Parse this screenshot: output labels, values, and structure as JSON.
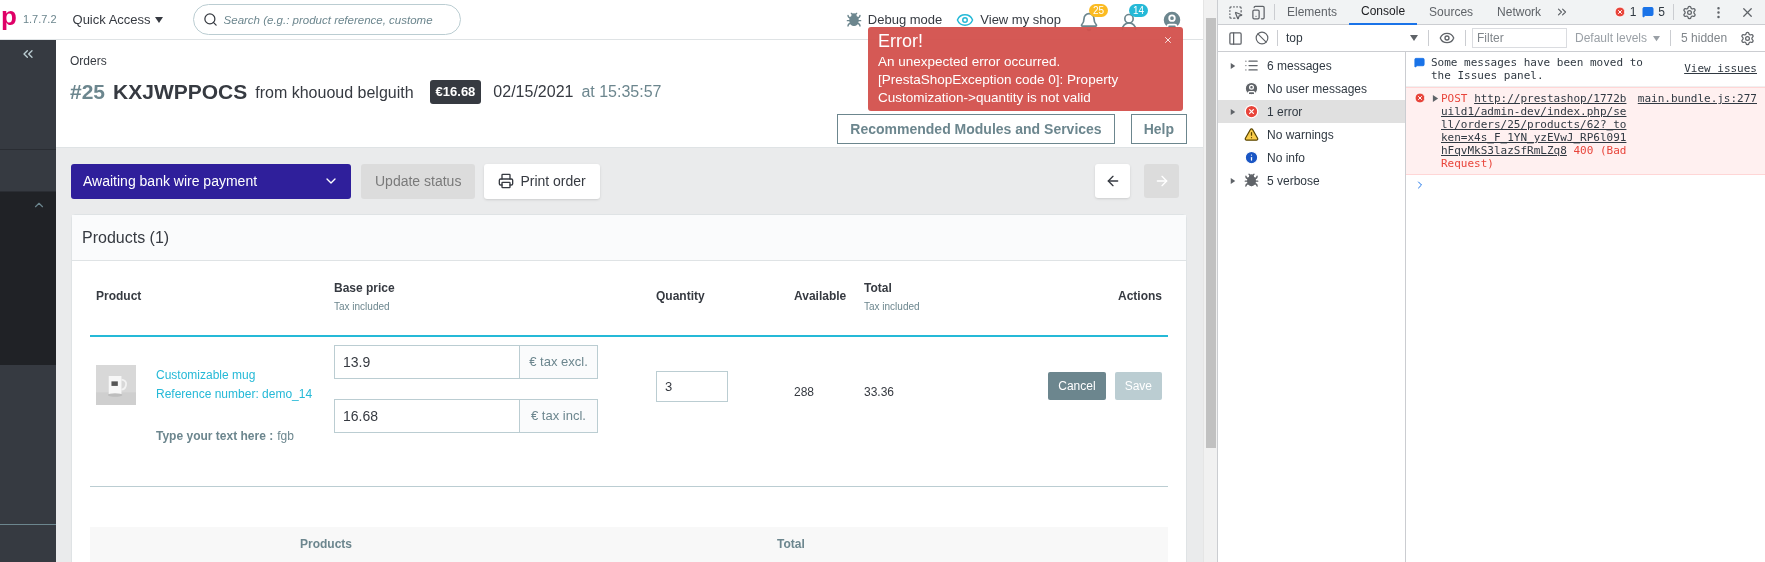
{
  "header": {
    "logo_text": "p",
    "version": "1.7.7.2",
    "quick_access": "Quick Access",
    "search": {
      "placeholder": "Search (e.g.: product reference, custome"
    },
    "debug_mode": "Debug mode",
    "view_shop": "View my shop",
    "notifications": [
      {
        "kind": "orders",
        "count": "25",
        "color": "#fbbb22"
      },
      {
        "kind": "customers",
        "count": "14",
        "color": "#25b9d7"
      }
    ]
  },
  "page_head": {
    "breadcrumb": "Orders",
    "order_number": "#25",
    "reference": "KXJWPPOCS",
    "customer": "from khououd belguith",
    "total": "€16.68",
    "date": "02/15/2021",
    "time": "at 15:35:57",
    "buttons": [
      "Recommended Modules and Services",
      "Help"
    ]
  },
  "toast": {
    "title": "Error!",
    "message": "An unexpected error occurred. [PrestaShopException code 0]: Property Customization->quantity is not valid"
  },
  "toolbar": {
    "status": "Awaiting bank wire payment",
    "update_button": {
      "label": "Update status",
      "disabled": true
    },
    "print_button": "Print order",
    "nav": [
      {
        "kind": "previous",
        "disabled": false
      },
      {
        "kind": "next",
        "disabled": true
      }
    ]
  },
  "products": {
    "title": "Products (1)",
    "columns": [
      {
        "label": "Product"
      },
      {
        "label": "Base price",
        "note": "Tax included"
      },
      {
        "label": "Quantity"
      },
      {
        "label": "Available"
      },
      {
        "label": "Total",
        "note": "Tax included"
      },
      {
        "label": "Actions"
      }
    ],
    "rows": [
      {
        "name": "Customizable mug",
        "reference": "Reference number: demo_14",
        "customization_label": "Type your text here :",
        "customization_value": "fgb",
        "prices": [
          {
            "value": "13.9",
            "addon": "€ tax excl."
          },
          {
            "value": "16.68",
            "addon": "€ tax incl."
          }
        ],
        "quantity": "3",
        "available": "288",
        "total": "33.36",
        "actions": [
          {
            "label": "Cancel",
            "disabled": false
          },
          {
            "label": "Save",
            "disabled": true
          }
        ]
      }
    ],
    "summary_columns": [
      "Products",
      "Total"
    ]
  },
  "devtools": {
    "tabs": [
      {
        "label": "Elements",
        "selected": false
      },
      {
        "label": "Console",
        "selected": true
      },
      {
        "label": "Sources",
        "selected": false
      },
      {
        "label": "Network",
        "selected": false
      }
    ],
    "error_count": "1",
    "message_count": "5",
    "context": "top",
    "filter": {
      "placeholder": "Filter"
    },
    "levels": "Default levels",
    "hidden": "5 hidden",
    "sidebar": [
      {
        "kind": "messages",
        "label": "6 messages",
        "expandable": true,
        "selected": false
      },
      {
        "kind": "user",
        "label": "No user messages",
        "expandable": false,
        "selected": false
      },
      {
        "kind": "error",
        "label": "1 error",
        "expandable": true,
        "selected": true
      },
      {
        "kind": "warning",
        "label": "No warnings",
        "expandable": false,
        "selected": false
      },
      {
        "kind": "info",
        "label": "No info",
        "expandable": false,
        "selected": false
      },
      {
        "kind": "verbose",
        "label": "5 verbose",
        "expandable": true,
        "selected": false
      }
    ],
    "messages": [
      {
        "kind": "issues",
        "text": "Some messages have been moved to the Issues panel.",
        "link": "View issues"
      },
      {
        "kind": "error",
        "method": "POST",
        "url": "http://prestashop/1772build1/admin-dev/index.php/sell/orders/25/products/62?_token=x4s_F_1YN_yzEVwJ_RP6l091hFqvMkS3lazSfRmLZq8",
        "source": "main.bundle.js:277",
        "status": "400 (Bad Request)",
        "expanded": false
      }
    ]
  }
}
